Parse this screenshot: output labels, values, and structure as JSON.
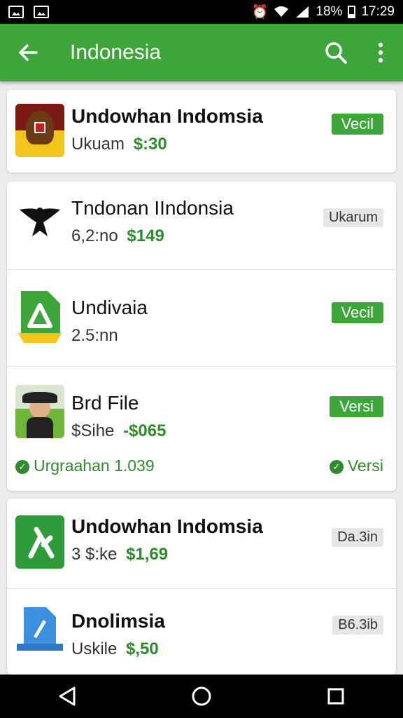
{
  "status_bar": {
    "battery": "18%",
    "time": "17:29"
  },
  "app_bar": {
    "title": "Indonesia"
  },
  "items": [
    {
      "name": "Undowhan Indomsia",
      "meta": "Ukuam",
      "price": "$:30",
      "action": "Vecil"
    },
    {
      "name": "Tndonan IIndonsia",
      "meta": "6,2:no",
      "price": "$149",
      "action": "Ukarum"
    },
    {
      "name": "Undivaia",
      "meta": "2.5:nn",
      "price": "",
      "action": "Vecil"
    },
    {
      "name": "Brd File",
      "meta": "$Sihe",
      "price": "-$065",
      "action": "Versi",
      "footer_left": "Urgraahan 1.039",
      "footer_right": "Versi"
    },
    {
      "name": "Undowhan Indomsia",
      "meta": "3 $:ke",
      "price": "$1,69",
      "action": "Da.3in"
    },
    {
      "name": "Dnolimsia",
      "meta": "Uskile",
      "price": "$,50",
      "action": "B6.3ib"
    }
  ],
  "colors": {
    "accent": "#3ea53b",
    "price": "#2f8b2c"
  }
}
